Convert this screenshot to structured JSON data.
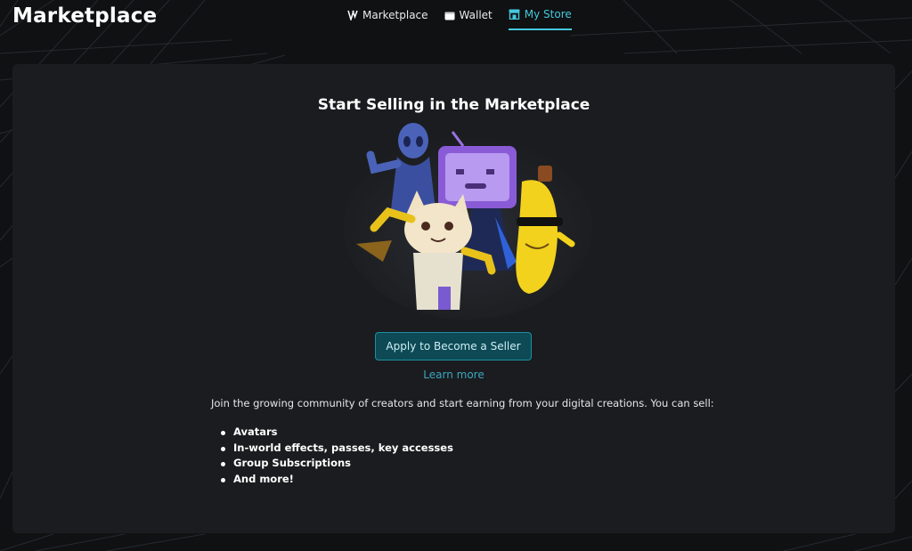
{
  "header": {
    "title": "Marketplace",
    "nav": [
      {
        "label": "Marketplace",
        "icon": "vrchat-logo-icon",
        "active": false
      },
      {
        "label": "Wallet",
        "icon": "wallet-icon",
        "active": false
      },
      {
        "label": "My Store",
        "icon": "store-icon",
        "active": true
      }
    ]
  },
  "main": {
    "title": "Start Selling in the Marketplace",
    "illustration": "marketplace-characters-illustration",
    "apply_button": "Apply to Become a Seller",
    "learn_more": "Learn more",
    "intro": "Join the growing community of creators and start earning from your digital creations. You can sell:",
    "sell_items": [
      "Avatars",
      "In-world effects, passes, key accesses",
      "Group Subscriptions",
      "And more!"
    ]
  },
  "colors": {
    "accent": "#46c8dc",
    "button_bg": "#0d4a55",
    "panel_bg": "#1a1c1f",
    "page_bg": "#0f1113"
  }
}
